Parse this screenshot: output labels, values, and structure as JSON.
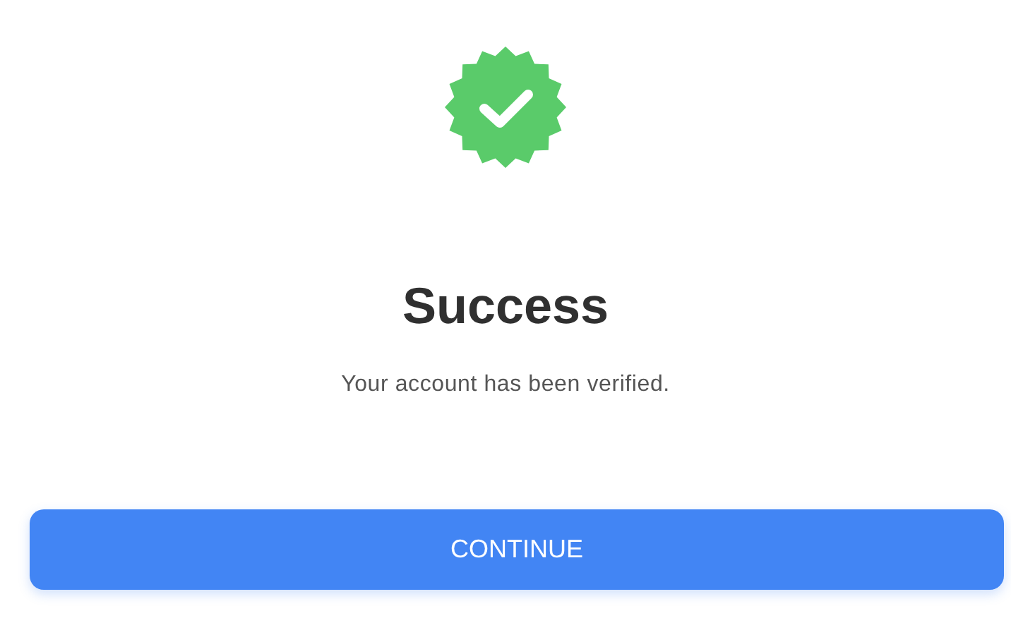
{
  "title": "Success",
  "message": "Your account has been verified.",
  "button": {
    "label": "CONTINUE"
  }
}
